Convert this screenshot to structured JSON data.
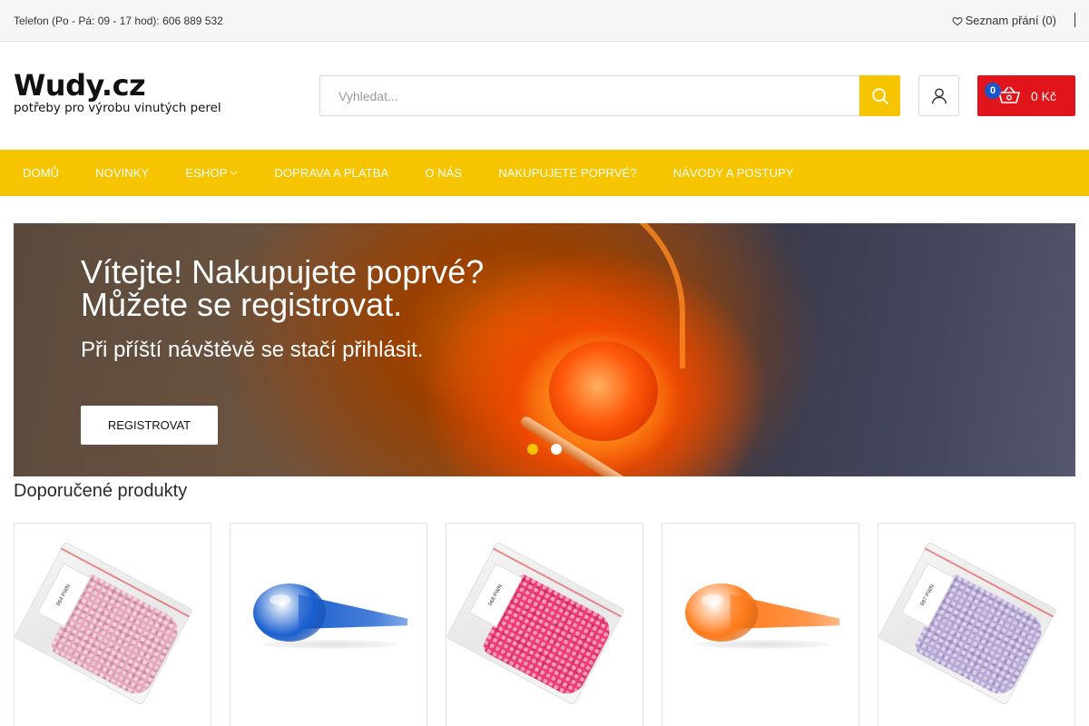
{
  "topbar": {
    "phone": "Telefon (Po - Pá: 09 - 17 hod): 606 889 532",
    "wishlist": "Seznam přání (0)"
  },
  "logo": {
    "name": "Wudy.cz",
    "tagline": "potřeby pro výrobu vinutých perel"
  },
  "search": {
    "placeholder": "Vyhledat..."
  },
  "cart": {
    "count": "0",
    "total": "0 Kč"
  },
  "nav": {
    "items": [
      {
        "label": "DOMŮ"
      },
      {
        "label": "NOVINKY"
      },
      {
        "label": "ESHOP"
      },
      {
        "label": "DOPRAVA A PLATBA"
      },
      {
        "label": "O NÁS"
      },
      {
        "label": "NAKUPUJETE POPRVÉ?"
      },
      {
        "label": "NÁVODY A POSTUPY"
      }
    ]
  },
  "hero": {
    "heading_line1": "Vítejte! Nakupujete poprvé?",
    "heading_line2": "Můžete se registrovat.",
    "subheading": "Při příští návštěvě se stačí přihlásit.",
    "button": "REGISTROVAT",
    "slides": 2,
    "active_slide": 1
  },
  "recommended": {
    "title": "Doporučené produkty",
    "products": [
      {
        "kind": "bag",
        "color": "#e7a6ba",
        "label": "064 PWN"
      },
      {
        "kind": "drop",
        "color": "#1a5fd0"
      },
      {
        "kind": "bag",
        "color": "#f03a78",
        "label": "068 PWN"
      },
      {
        "kind": "drop",
        "color": "#ff7a1a"
      },
      {
        "kind": "bag",
        "color": "#b8a8d8",
        "label": "087 PWN"
      }
    ]
  },
  "colors": {
    "accent": "#f7c500",
    "cart": "#e1141b",
    "badge": "#1a56c8"
  }
}
